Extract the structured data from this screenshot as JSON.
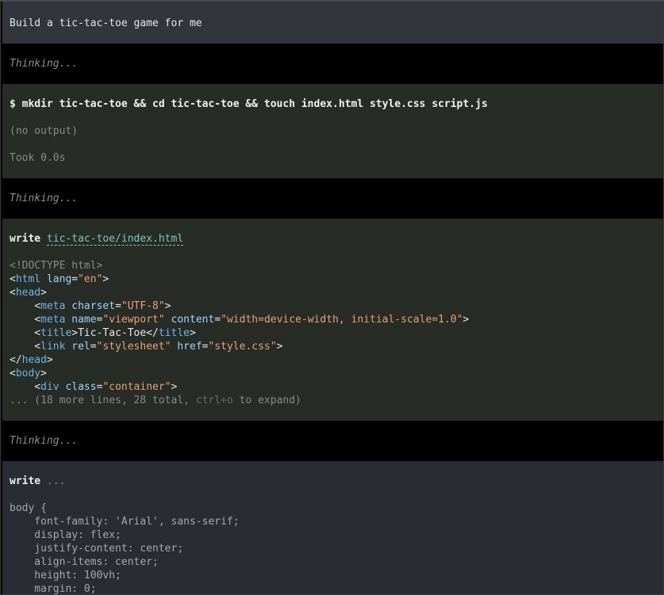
{
  "user_message": "Build a tic-tac-toe game for me",
  "thinking_label": "Thinking...",
  "bash": {
    "command": "$ mkdir tic-tac-toe && cd tic-tac-toe && touch index.html style.css script.js",
    "output": "(no output)",
    "duration": "Took 0.0s"
  },
  "write1": {
    "verb": "write",
    "path": "tic-tac-toe/index.html",
    "lines": {
      "l1": "<!DOCTYPE html>",
      "l2_open": "<",
      "l2_tag": "html",
      "l2_attr": " lang",
      "l2_eq": "=",
      "l2_val": "\"en\"",
      "l2_close": ">",
      "l3_open": "<",
      "l3_tag": "head",
      "l3_close": ">",
      "l4_indent": "    <",
      "l4_tag": "meta",
      "l4_attr": " charset",
      "l4_eq": "=",
      "l4_val": "\"UTF-8\"",
      "l4_close": ">",
      "l5_indent": "    <",
      "l5_tag": "meta",
      "l5_attr1": " name",
      "l5_eq1": "=",
      "l5_val1": "\"viewport\"",
      "l5_attr2": " content",
      "l5_eq2": "=",
      "l5_val2": "\"width=device-width, initial-scale=1.0\"",
      "l5_close": ">",
      "l6_indent": "    <",
      "l6_tag": "title",
      "l6_mid": ">Tic-Tac-Toe</",
      "l6_tag2": "title",
      "l6_close": ">",
      "l7_indent": "    <",
      "l7_tag": "link",
      "l7_attr1": " rel",
      "l7_eq1": "=",
      "l7_val1": "\"stylesheet\"",
      "l7_attr2": " href",
      "l7_eq2": "=",
      "l7_val2": "\"style.css\"",
      "l7_close": ">",
      "l8_open": "</",
      "l8_tag": "head",
      "l8_close": ">",
      "l9_open": "<",
      "l9_tag": "body",
      "l9_close": ">",
      "l10_indent": "    <",
      "l10_tag": "div",
      "l10_attr": " class",
      "l10_eq": "=",
      "l10_val": "\"container\"",
      "l10_close": ">"
    },
    "more_prefix": "... (18 more lines, 28 total, ",
    "more_key": "ctrl+o",
    "more_suffix": " to expand)"
  },
  "write2": {
    "verb": "write",
    "path": "...",
    "css_lines": [
      "body {",
      "    font-family: 'Arial', sans-serif;",
      "    display: flex;",
      "    justify-content: center;",
      "    align-items: center;",
      "    height: 100vh;",
      "    margin: 0;"
    ]
  }
}
